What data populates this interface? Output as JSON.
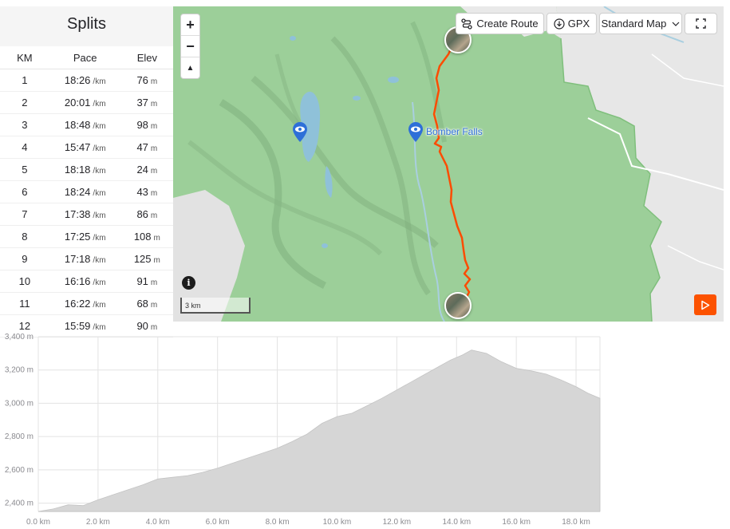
{
  "splits": {
    "title": "Splits",
    "headers": {
      "km": "KM",
      "pace": "Pace",
      "elev": "Elev"
    },
    "rows": [
      {
        "km": "1",
        "pace": "18:26",
        "pace_unit": "/km",
        "elev": "76",
        "elev_unit": "m"
      },
      {
        "km": "2",
        "pace": "20:01",
        "pace_unit": "/km",
        "elev": "37",
        "elev_unit": "m"
      },
      {
        "km": "3",
        "pace": "18:48",
        "pace_unit": "/km",
        "elev": "98",
        "elev_unit": "m"
      },
      {
        "km": "4",
        "pace": "15:47",
        "pace_unit": "/km",
        "elev": "47",
        "elev_unit": "m"
      },
      {
        "km": "5",
        "pace": "18:18",
        "pace_unit": "/km",
        "elev": "24",
        "elev_unit": "m"
      },
      {
        "km": "6",
        "pace": "18:24",
        "pace_unit": "/km",
        "elev": "43",
        "elev_unit": "m"
      },
      {
        "km": "7",
        "pace": "17:38",
        "pace_unit": "/km",
        "elev": "86",
        "elev_unit": "m"
      },
      {
        "km": "8",
        "pace": "17:25",
        "pace_unit": "/km",
        "elev": "108",
        "elev_unit": "m"
      },
      {
        "km": "9",
        "pace": "17:18",
        "pace_unit": "/km",
        "elev": "125",
        "elev_unit": "m"
      },
      {
        "km": "10",
        "pace": "16:16",
        "pace_unit": "/km",
        "elev": "91",
        "elev_unit": "m"
      },
      {
        "km": "11",
        "pace": "16:22",
        "pace_unit": "/km",
        "elev": "68",
        "elev_unit": "m"
      },
      {
        "km": "12",
        "pace": "15:59",
        "pace_unit": "/km",
        "elev": "90",
        "elev_unit": "m"
      }
    ]
  },
  "map": {
    "create_route_label": "Create Route",
    "gpx_label": "GPX",
    "map_style_label": "Standard Map",
    "zoom_in": "+",
    "zoom_out": "−",
    "compass": "▲",
    "poi_label": "Bomber Falls",
    "scale_label": "3 km",
    "info_label": "i",
    "icons": [
      "route-icon",
      "download-icon",
      "chevron-down-icon",
      "fullscreen-icon",
      "play-icon",
      "info-icon",
      "eye-icon",
      "compass-icon"
    ],
    "colors": {
      "route": "#fc4c02",
      "poi": "#2e6fd8",
      "play_button": "#fc5200",
      "forest": "#9ccf99",
      "open_land": "#e7e7e7"
    }
  },
  "chart_data": {
    "type": "area",
    "xlabel": "",
    "ylabel": "",
    "x_unit": "km",
    "y_unit": "m",
    "xlim": [
      0,
      18.8
    ],
    "ylim": [
      2350,
      3400
    ],
    "x_ticks": [
      "0.0 km",
      "2.0 km",
      "4.0 km",
      "6.0 km",
      "8.0 km",
      "10.0 km",
      "12.0 km",
      "14.0 km",
      "16.0 km",
      "18.0 km"
    ],
    "x_tick_values": [
      0,
      2,
      4,
      6,
      8,
      10,
      12,
      14,
      16,
      18
    ],
    "y_ticks": [
      "2,400 m",
      "2,600 m",
      "2,800 m",
      "3,000 m",
      "3,200 m",
      "3,400 m"
    ],
    "y_tick_values": [
      2400,
      2600,
      2800,
      3000,
      3200,
      3400
    ],
    "grid": true,
    "fill_color": "#d6d6d6",
    "series": [
      {
        "x": [
          0,
          0.5,
          1.0,
          1.5,
          2.0,
          2.5,
          3.0,
          3.5,
          4.0,
          4.5,
          5.0,
          5.5,
          6.0,
          6.5,
          7.0,
          7.5,
          8.0,
          8.5,
          9.0,
          9.5,
          10.0,
          10.5,
          11.0,
          11.5,
          12.0,
          12.5,
          13.0,
          13.5,
          13.8,
          14.2,
          14.5,
          15.0,
          15.5,
          16.0,
          16.5,
          17.0,
          17.5,
          18.0,
          18.4,
          18.8
        ],
        "y": [
          2350,
          2365,
          2390,
          2385,
          2420,
          2450,
          2480,
          2510,
          2545,
          2555,
          2565,
          2585,
          2610,
          2640,
          2670,
          2700,
          2730,
          2770,
          2815,
          2880,
          2920,
          2940,
          2985,
          3030,
          3080,
          3130,
          3180,
          3230,
          3260,
          3290,
          3320,
          3300,
          3250,
          3210,
          3195,
          3175,
          3140,
          3100,
          3060,
          3030
        ]
      }
    ]
  }
}
